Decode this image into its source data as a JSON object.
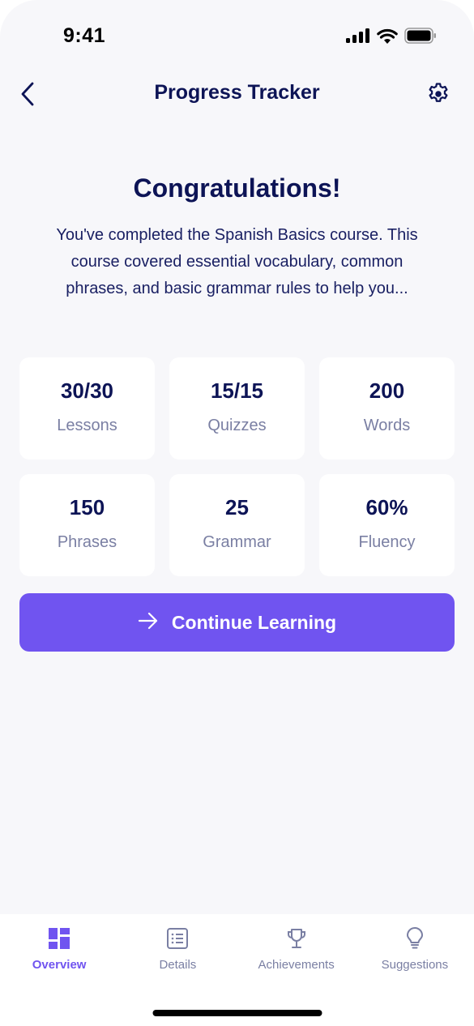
{
  "status_bar": {
    "time": "9:41"
  },
  "header": {
    "title": "Progress Tracker",
    "back_icon": "chevron-left-icon",
    "settings_icon": "gear-icon"
  },
  "main": {
    "heading": "Congratulations!",
    "description": "You've completed the Spanish Basics course. This course covered essential vocabulary, common phrases, and basic grammar rules to help you...",
    "stats": [
      {
        "value": "30/30",
        "label": "Lessons"
      },
      {
        "value": "15/15",
        "label": "Quizzes"
      },
      {
        "value": "200",
        "label": "Words"
      },
      {
        "value": "150",
        "label": "Phrases"
      },
      {
        "value": "25",
        "label": "Grammar"
      },
      {
        "value": "60%",
        "label": "Fluency"
      }
    ],
    "cta": {
      "label": "Continue Learning",
      "icon": "arrow-right-icon"
    }
  },
  "tabbar": {
    "items": [
      {
        "label": "Overview",
        "icon": "dashboard-icon",
        "active": true
      },
      {
        "label": "Details",
        "icon": "list-icon",
        "active": false
      },
      {
        "label": "Achievements",
        "icon": "trophy-icon",
        "active": false
      },
      {
        "label": "Suggestions",
        "icon": "lightbulb-icon",
        "active": false
      }
    ]
  },
  "colors": {
    "accent": "#7054f0",
    "heading": "#0d1456",
    "muted": "#7a7fa3",
    "background": "#f7f7fa",
    "card": "#ffffff"
  }
}
